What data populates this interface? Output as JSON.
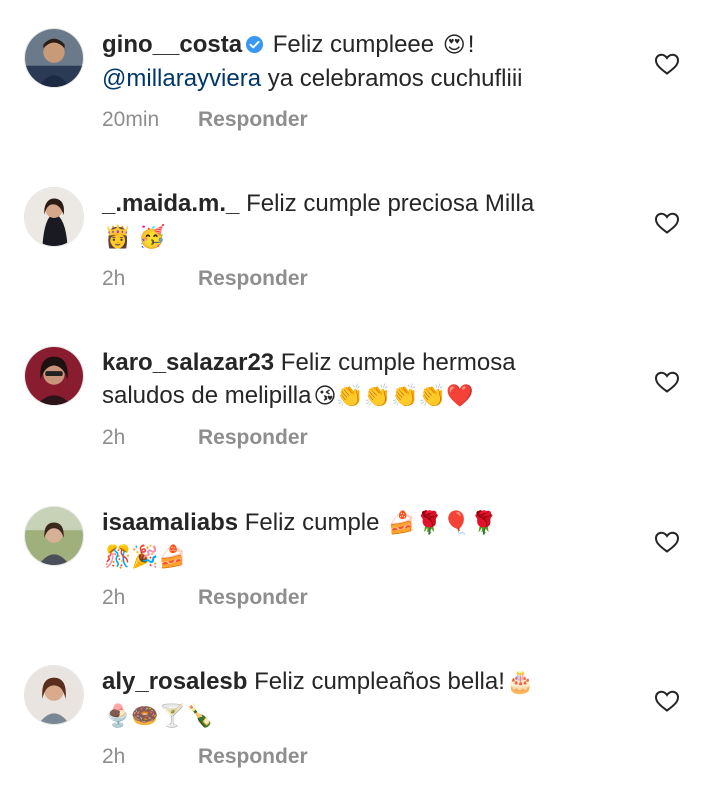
{
  "comments": [
    {
      "username": "gino__costa",
      "verified": true,
      "text_before": " Feliz cumpleee ",
      "emoji1": "😍",
      "text_after": "!",
      "mention": "@millarayviera",
      "line2": " ya celebramos cuchufliii",
      "time": "20min",
      "reply_label": "Responder"
    },
    {
      "username": "_.maida.m._",
      "text": " Feliz cumple preciosa Milla",
      "emojis": "👸 🥳",
      "time": "2h",
      "reply_label": "Responder"
    },
    {
      "username": "karo_salazar23",
      "text": " Feliz cumple hermosa",
      "line2": "saludos de melipilla",
      "emojis": "😘👏👏👏👏❤️",
      "time": "2h",
      "reply_label": "Responder"
    },
    {
      "username": "isaamaliabs",
      "text": " Feliz cumple ",
      "emojis1": "🍰🌹🎈🌹",
      "emojis2": "🎊🎉🍰",
      "time": "2h",
      "reply_label": "Responder"
    },
    {
      "username": "aly_rosalesb",
      "text": " Feliz cumpleaños bella!",
      "emojis1": "🎂",
      "emojis2": "🍨🍩🍸🍾",
      "time": "2h",
      "reply_label": "Responder"
    }
  ],
  "icons": {
    "verified": "verified-badge-icon",
    "like": "heart-outline-icon"
  },
  "colors": {
    "text": "#262626",
    "meta": "#8e8e8e",
    "mention": "#00376b",
    "verified": "#3897f0"
  }
}
